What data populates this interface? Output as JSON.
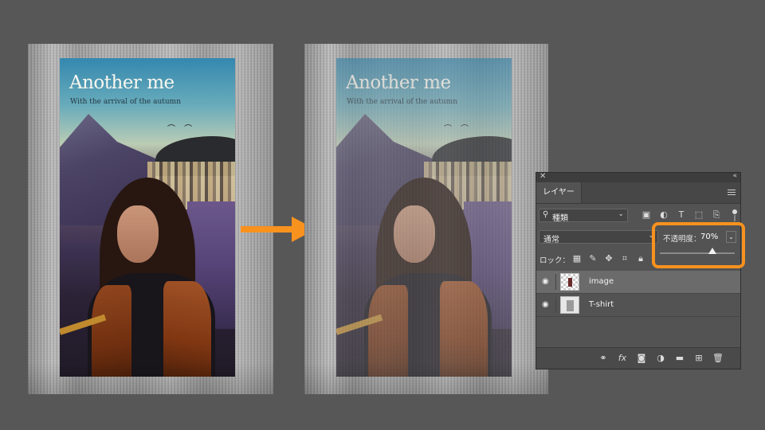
{
  "before": {
    "print_title": "Another me",
    "print_subtitle": "With the arrival of the autumn"
  },
  "after": {
    "print_title": "Another me",
    "print_subtitle": "With the arrival of the autumn"
  },
  "colors": {
    "accent": "#f7921e",
    "background": "#575757",
    "panel": "#535353"
  },
  "layers_panel": {
    "tab_label": "レイヤー",
    "filter": {
      "icon": "search-icon",
      "value": "種類",
      "icons": [
        "image-filter-icon",
        "adjustment-filter-icon",
        "type-filter-icon",
        "shape-filter-icon",
        "smart-object-filter-icon"
      ]
    },
    "blend_mode": "通常",
    "opacity_label": "不透明度：",
    "opacity_value": "70%",
    "opacity_fraction": 0.7,
    "lock_label": "ロック：",
    "lock_icons": [
      "lock-transparent-icon",
      "lock-paint-icon",
      "lock-position-icon",
      "lock-artboard-icon",
      "lock-all-icon"
    ],
    "layers": [
      {
        "name": "image",
        "visible": true,
        "selected": true
      },
      {
        "name": "T-shirt",
        "visible": true,
        "selected": false
      }
    ],
    "bottom_icons": [
      "link-icon",
      "fx-icon",
      "mask-icon",
      "adjustment-icon",
      "folder-icon",
      "new-layer-icon",
      "trash-icon"
    ]
  }
}
